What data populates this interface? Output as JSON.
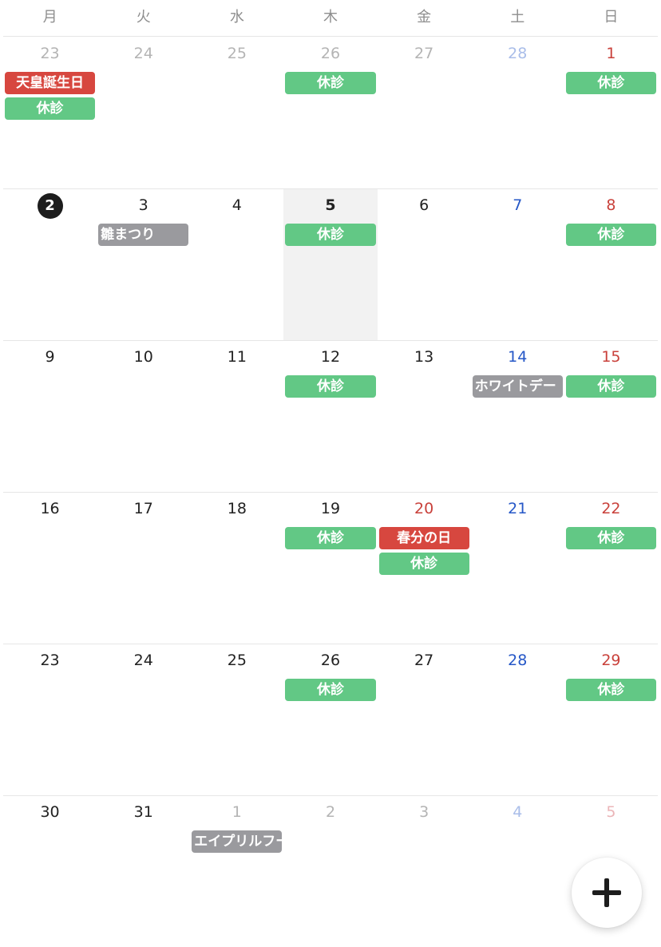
{
  "weekdays": [
    "月",
    "火",
    "水",
    "木",
    "金",
    "土",
    "日"
  ],
  "fab": {
    "icon": "plus-icon"
  },
  "weeks": [
    [
      {
        "num": "23",
        "tone": "out",
        "events": [
          {
            "label": "天皇誕生日",
            "kind": "red"
          },
          {
            "label": "休診",
            "kind": "green"
          }
        ]
      },
      {
        "num": "24",
        "tone": "out",
        "events": []
      },
      {
        "num": "25",
        "tone": "out",
        "events": []
      },
      {
        "num": "26",
        "tone": "out",
        "events": [
          {
            "label": "休診",
            "kind": "green"
          }
        ]
      },
      {
        "num": "27",
        "tone": "out",
        "events": []
      },
      {
        "num": "28",
        "tone": "out-sat",
        "events": []
      },
      {
        "num": "1",
        "tone": "sun",
        "events": [
          {
            "label": "休診",
            "kind": "green"
          }
        ]
      }
    ],
    [
      {
        "num": "2",
        "tone": "normal",
        "selected": true,
        "events": []
      },
      {
        "num": "3",
        "tone": "normal",
        "events": [
          {
            "label": "雛まつり",
            "kind": "gray"
          }
        ]
      },
      {
        "num": "4",
        "tone": "normal",
        "events": []
      },
      {
        "num": "5",
        "tone": "normal",
        "today": true,
        "events": [
          {
            "label": "休診",
            "kind": "green"
          }
        ]
      },
      {
        "num": "6",
        "tone": "normal",
        "events": []
      },
      {
        "num": "7",
        "tone": "sat",
        "events": []
      },
      {
        "num": "8",
        "tone": "sun",
        "events": [
          {
            "label": "休診",
            "kind": "green"
          }
        ]
      }
    ],
    [
      {
        "num": "9",
        "tone": "normal",
        "events": []
      },
      {
        "num": "10",
        "tone": "normal",
        "events": []
      },
      {
        "num": "11",
        "tone": "normal",
        "events": []
      },
      {
        "num": "12",
        "tone": "normal",
        "events": [
          {
            "label": "休診",
            "kind": "green"
          }
        ]
      },
      {
        "num": "13",
        "tone": "normal",
        "events": []
      },
      {
        "num": "14",
        "tone": "sat",
        "events": [
          {
            "label": "ホワイトデー",
            "kind": "gray"
          }
        ]
      },
      {
        "num": "15",
        "tone": "sun",
        "events": [
          {
            "label": "休診",
            "kind": "green"
          }
        ]
      }
    ],
    [
      {
        "num": "16",
        "tone": "normal",
        "events": []
      },
      {
        "num": "17",
        "tone": "normal",
        "events": []
      },
      {
        "num": "18",
        "tone": "normal",
        "events": []
      },
      {
        "num": "19",
        "tone": "normal",
        "events": [
          {
            "label": "休診",
            "kind": "green"
          }
        ]
      },
      {
        "num": "20",
        "tone": "sun",
        "events": [
          {
            "label": "春分の日",
            "kind": "red"
          },
          {
            "label": "休診",
            "kind": "green"
          }
        ]
      },
      {
        "num": "21",
        "tone": "sat",
        "events": []
      },
      {
        "num": "22",
        "tone": "sun",
        "events": [
          {
            "label": "休診",
            "kind": "green"
          }
        ]
      }
    ],
    [
      {
        "num": "23",
        "tone": "normal",
        "events": []
      },
      {
        "num": "24",
        "tone": "normal",
        "events": []
      },
      {
        "num": "25",
        "tone": "normal",
        "events": []
      },
      {
        "num": "26",
        "tone": "normal",
        "events": [
          {
            "label": "休診",
            "kind": "green"
          }
        ]
      },
      {
        "num": "27",
        "tone": "normal",
        "events": []
      },
      {
        "num": "28",
        "tone": "sat",
        "events": []
      },
      {
        "num": "29",
        "tone": "sun",
        "events": [
          {
            "label": "休診",
            "kind": "green"
          }
        ]
      }
    ],
    [
      {
        "num": "30",
        "tone": "normal",
        "events": []
      },
      {
        "num": "31",
        "tone": "normal",
        "events": []
      },
      {
        "num": "1",
        "tone": "out",
        "events": [
          {
            "label": "エイプリルフール",
            "kind": "gray"
          }
        ]
      },
      {
        "num": "2",
        "tone": "out",
        "events": []
      },
      {
        "num": "3",
        "tone": "out",
        "events": []
      },
      {
        "num": "4",
        "tone": "out-sat",
        "events": []
      },
      {
        "num": "5",
        "tone": "out-sun",
        "events": []
      }
    ]
  ]
}
